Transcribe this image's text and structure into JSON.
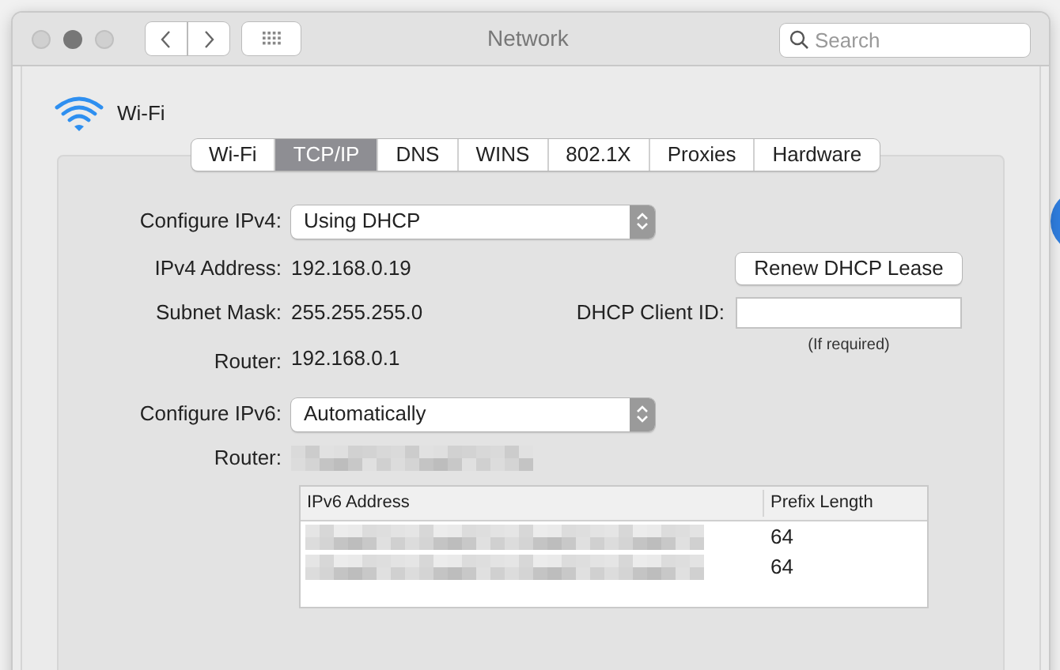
{
  "window": {
    "title": "Network",
    "traffic_lights": [
      {
        "active": false
      },
      {
        "active": true
      },
      {
        "active": false
      }
    ]
  },
  "search": {
    "placeholder": "Search"
  },
  "service": {
    "name": "Wi-Fi"
  },
  "tabs": [
    {
      "label": "Wi-Fi",
      "selected": false
    },
    {
      "label": "TCP/IP",
      "selected": true
    },
    {
      "label": "DNS",
      "selected": false
    },
    {
      "label": "WINS",
      "selected": false
    },
    {
      "label": "802.1X",
      "selected": false
    },
    {
      "label": "Proxies",
      "selected": false
    },
    {
      "label": "Hardware",
      "selected": false
    }
  ],
  "configure_ipv4": {
    "label": "Configure IPv4:",
    "value": "Using DHCP"
  },
  "ipv4_address": {
    "label": "IPv4 Address:",
    "value": "192.168.0.19"
  },
  "subnet_mask": {
    "label": "Subnet Mask:",
    "value": "255.255.255.0"
  },
  "router": {
    "label": "Router:",
    "value": "192.168.0.1"
  },
  "renew_button": "Renew DHCP Lease",
  "dhcp_client_id": {
    "label": "DHCP Client ID:",
    "hint": "(If required)"
  },
  "configure_ipv6": {
    "label": "Configure IPv6:",
    "value": "Automatically"
  },
  "router_ipv6": {
    "label": "Router:",
    "redacted": true
  },
  "ipv6_table": {
    "columns": [
      "IPv6 Address",
      "Prefix Length"
    ],
    "rows": [
      {
        "address_redacted": true,
        "prefix": "64"
      },
      {
        "address_redacted": true,
        "prefix": "64"
      }
    ]
  }
}
